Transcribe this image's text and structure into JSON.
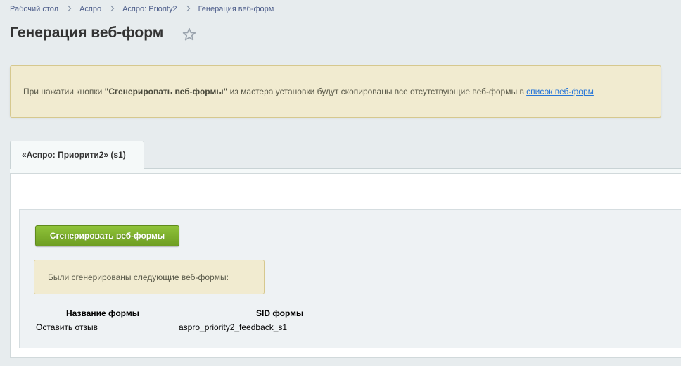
{
  "breadcrumb": {
    "items": [
      "Рабочий стол",
      "Аспро",
      "Аспро: Priority2",
      "Генерация веб-форм"
    ]
  },
  "page": {
    "title": "Генерация веб-форм",
    "favorite_icon": "star-icon"
  },
  "info_note": {
    "text_before": "При нажатии кнопки ",
    "button_name": "\"Сгенерировать веб-формы\"",
    "text_after": " из мастера установки будут скопированы все отсутствующие веб-формы в ",
    "link_text": "список веб-форм"
  },
  "tabs": [
    {
      "label": "«Аспро: Приорити2» (s1)",
      "active": true
    }
  ],
  "generate_button": {
    "label": "Сгенерировать веб-формы",
    "color": "#7cae2b"
  },
  "result_note": {
    "text": "Были сгенерированы следующие веб-формы:"
  },
  "forms_table": {
    "columns": [
      "Название формы",
      "SID формы"
    ],
    "rows": [
      [
        "Оставить отзыв",
        "aspro_priority2_feedback_s1"
      ]
    ]
  },
  "colors": {
    "background": "#e7ecee",
    "note_background": "#f1ebd0",
    "link": "#2675d7",
    "button_green": "#7cae2b"
  }
}
